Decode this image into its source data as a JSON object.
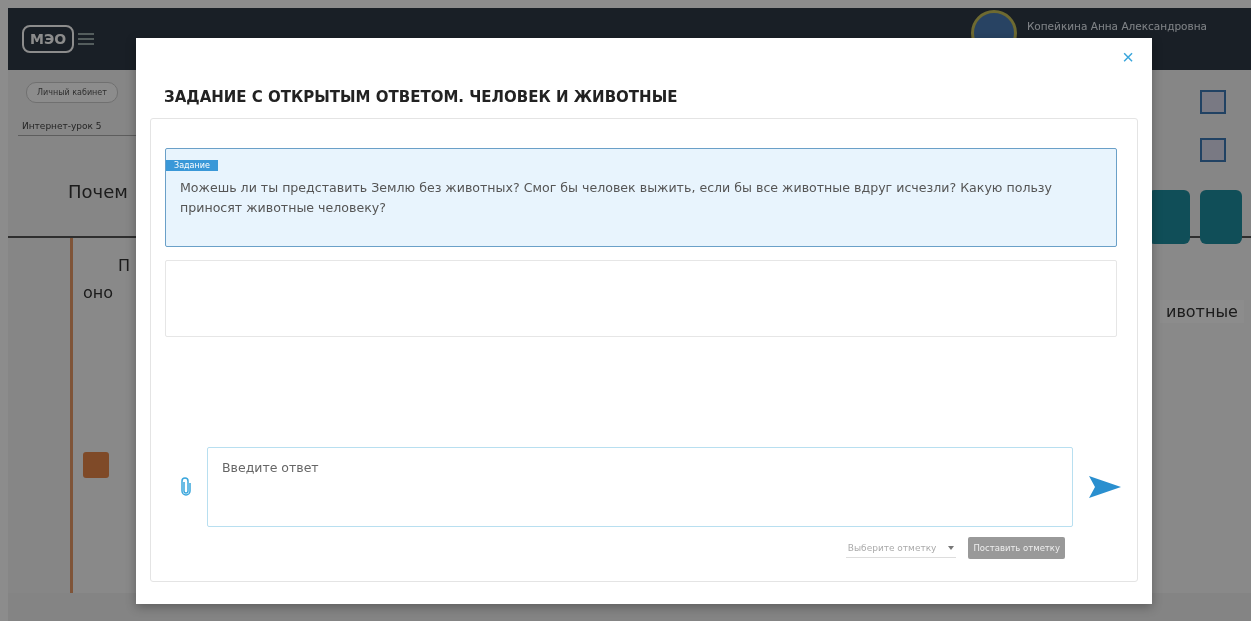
{
  "background_page": {
    "logo": "МЭО",
    "user_name": "Копейкина Анна Александровна",
    "breadcrumb": "Личный кабинет",
    "lesson_select": "Интернет-урок 5",
    "heading": "Почем",
    "text_lines": [
      "П",
      "оно"
    ],
    "tab_label": "ивотные"
  },
  "dialog": {
    "title": "ЗАДАНИЕ С ОТКРЫТЫМ ОТВЕТОМ. ЧЕЛОВЕК И ЖИВОТНЫЕ",
    "close": "×",
    "task": {
      "badge": "Задание",
      "text": "Можешь ли ты представить Землю без животных? Смог бы человек выжить, если бы все животные вдруг исчезли? Какую пользу приносят животные человеку?"
    },
    "answer": {
      "placeholder": "Введите ответ"
    },
    "grade_select": {
      "placeholder": "Выберите отметку"
    },
    "grade_button": {
      "label": "Поставить отметку",
      "disabled": true
    }
  }
}
